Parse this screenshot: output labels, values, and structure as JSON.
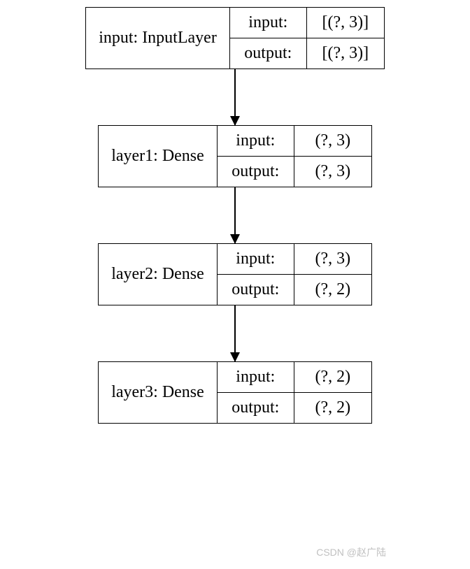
{
  "layers": [
    {
      "label": "input: InputLayer",
      "input_key": "input:",
      "input_val": "[(?, 3)]",
      "output_key": "output:",
      "output_val": "[(?, 3)]"
    },
    {
      "label": "layer1: Dense",
      "input_key": "input:",
      "input_val": "(?, 3)",
      "output_key": "output:",
      "output_val": "(?, 3)"
    },
    {
      "label": "layer2: Dense",
      "input_key": "input:",
      "input_val": "(?, 3)",
      "output_key": "output:",
      "output_val": "(?, 2)"
    },
    {
      "label": "layer3: Dense",
      "input_key": "input:",
      "input_val": "(?, 2)",
      "output_key": "output:",
      "output_val": "(?, 2)"
    }
  ],
  "watermark": "CSDN @赵广陆"
}
